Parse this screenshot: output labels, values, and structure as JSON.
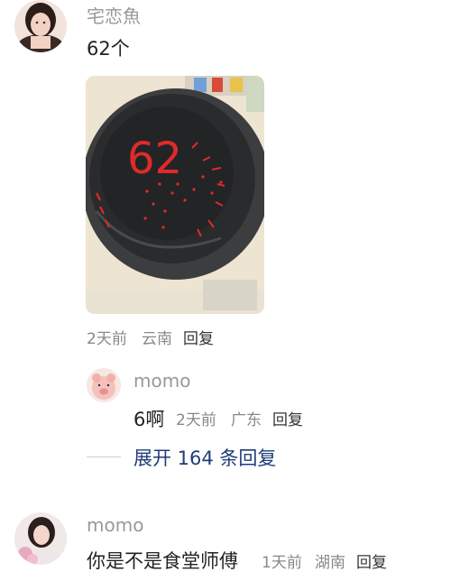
{
  "comments": [
    {
      "username": "宅恋魚",
      "text": "62个",
      "time": "2天前",
      "location": "云南",
      "reply_label": "回复",
      "photo_caption": "62",
      "replies": [
        {
          "username": "momo",
          "text": "6啊",
          "time": "2天前",
          "location": "广东",
          "reply_label": "回复"
        }
      ],
      "expand_label": "展开 164 条回复"
    },
    {
      "username": "momo",
      "text": "你是不是食堂师傅",
      "time": "1天前",
      "location": "湖南",
      "reply_label": "回复"
    }
  ]
}
